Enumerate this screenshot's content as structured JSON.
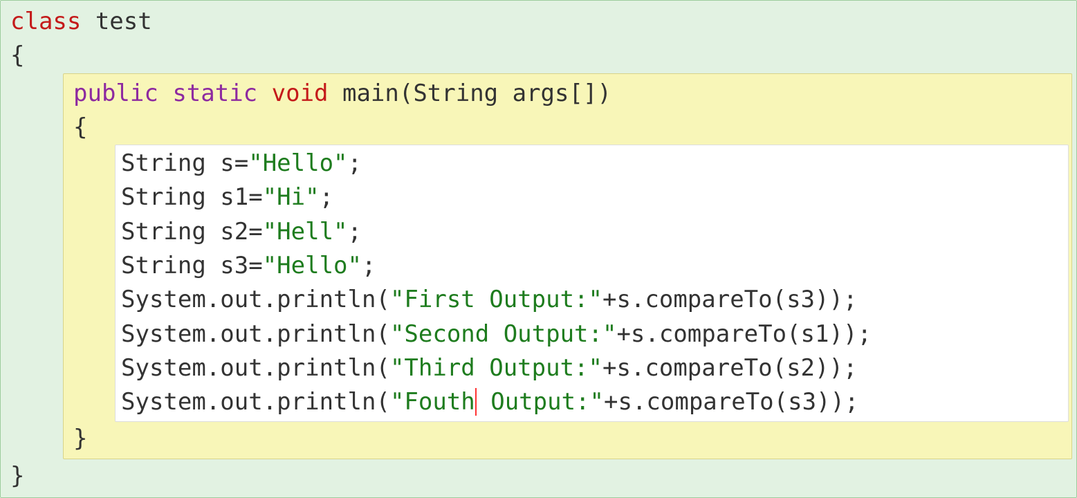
{
  "c": {
    "class_kw": "class",
    "class_name": " test",
    "obr0": "{",
    "cbr0": "}",
    "public_kw": "public",
    "sp1": " ",
    "static_kw": "static",
    "sp2": " ",
    "void_kw": "void",
    "main_sig": " main(String args[])",
    "obr1": "{",
    "cbr1": "}",
    "l1a": "String s=",
    "l1b": "\"Hello\"",
    "l1c": ";",
    "l2a": "String s1=",
    "l2b": "\"Hi\"",
    "l2c": ";",
    "l3a": "String s2=",
    "l3b": "\"Hell\"",
    "l3c": ";",
    "l4a": "String s3=",
    "l4b": "\"Hello\"",
    "l4c": ";",
    "p1a": "System.out.println(",
    "p1b": "\"First Output:\"",
    "p1c": "+s.compareTo(s3));",
    "p2a": "System.out.println(",
    "p2b": "\"Second Output:\"",
    "p2c": "+s.compareTo(s1));",
    "p3a": "System.out.println(",
    "p3b": "\"Third Output:\"",
    "p3c": "+s.compareTo(s2));",
    "p4a": "System.out.println(",
    "p4b1": "\"Fouth",
    "p4b2": " Output:\"",
    "p4c": "+s.compareTo(s3));"
  }
}
